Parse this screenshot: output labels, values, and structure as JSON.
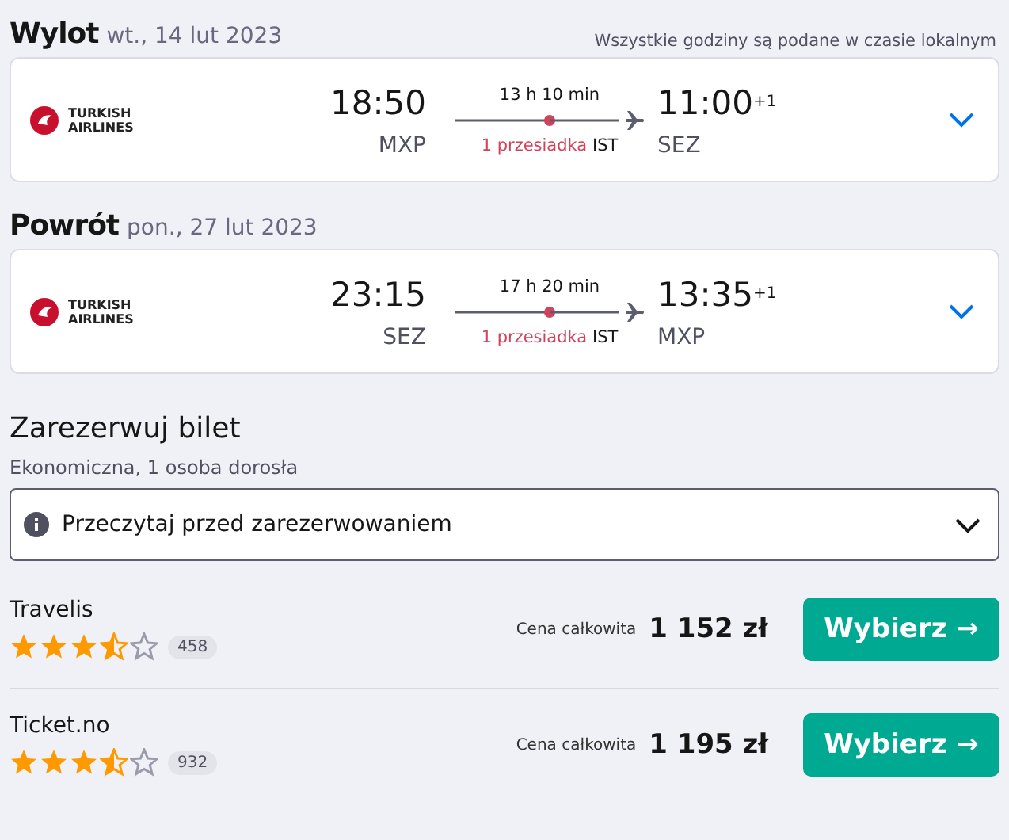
{
  "legs": [
    {
      "label": "Wylot",
      "date": "wt., 14 lut 2023",
      "note": "Wszystkie godziny są podane w czasie lokalnym",
      "airline": [
        "TURKISH",
        "AIRLINES"
      ],
      "depart_time": "18:50",
      "depart_airport": "MXP",
      "duration": "13 h 10 min",
      "stops": "1 przesiadka",
      "stop_airport": "IST",
      "arrive_time": "11:00",
      "day_offset": "+1",
      "arrive_airport": "SEZ",
      "expanded": false
    },
    {
      "label": "Powrót",
      "date": "pon., 27 lut 2023",
      "airline": [
        "TURKISH",
        "AIRLINES"
      ],
      "depart_time": "23:15",
      "depart_airport": "SEZ",
      "duration": "17 h 20 min",
      "stops": "1 przesiadka",
      "stop_airport": "IST",
      "arrive_time": "13:35",
      "day_offset": "+1",
      "arrive_airport": "MXP",
      "expanded": false
    }
  ],
  "booking": {
    "title": "Zarezerwuj bilet",
    "subtitle": "Ekonomiczna, 1 osoba dorosła",
    "notice": {
      "label": "Przeczytaj przed zarezerwowaniem",
      "expanded": false
    }
  },
  "offers": [
    {
      "provider": "Travelis",
      "stars": 3.5,
      "reviews": "458",
      "price_label": "Cena całkowita",
      "price": "1 152 zł",
      "button": "Wybierz →"
    },
    {
      "provider": "Ticket.no",
      "stars": 3.5,
      "reviews": "932",
      "price_label": "Cena całkowita",
      "price": "1 195 zł",
      "button": "Wybierz →"
    }
  ]
}
